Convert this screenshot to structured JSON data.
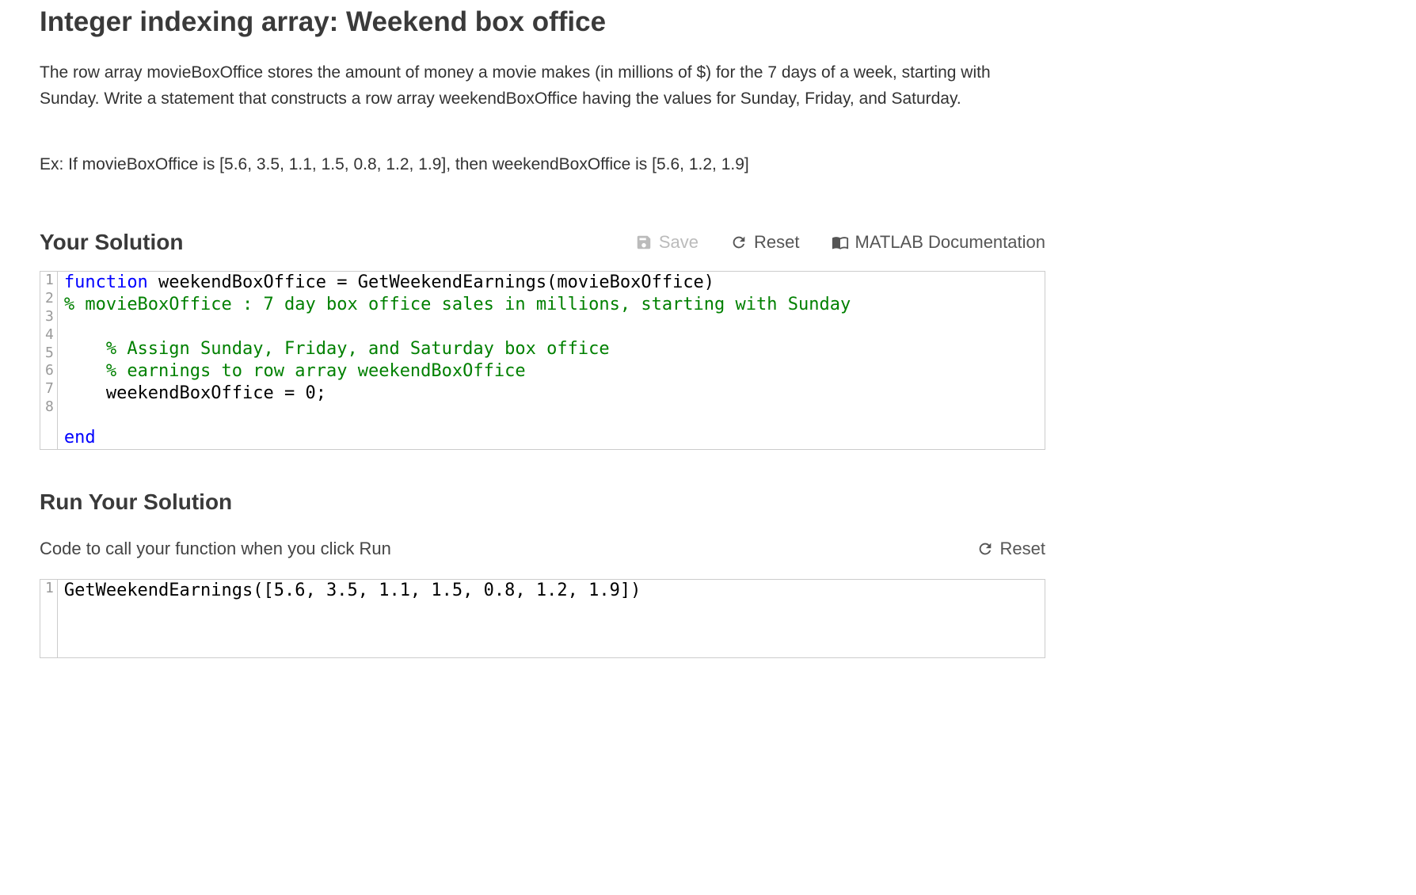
{
  "page_title": "Integer indexing array: Weekend box office",
  "description": "The row array movieBoxOffice stores the amount of money a movie makes (in millions of $) for the 7 days of a week, starting with Sunday. Write a statement that constructs a row array weekendBoxOffice having the values for Sunday, Friday, and Saturday.",
  "example": "Ex: If movieBoxOffice is [5.6, 3.5, 1.1, 1.5, 0.8, 1.2, 1.9], then weekendBoxOffice is [5.6, 1.2, 1.9]",
  "solution": {
    "title": "Your Solution",
    "toolbar": {
      "save": "Save",
      "reset": "Reset",
      "docs": "MATLAB Documentation"
    },
    "lines": [
      {
        "n": "1",
        "tokens": [
          {
            "t": "function",
            "c": "keyword"
          },
          {
            "t": " weekendBoxOffice = GetWeekendEarnings(movieBoxOffice)",
            "c": "plain"
          }
        ]
      },
      {
        "n": "2",
        "tokens": [
          {
            "t": "% movieBoxOffice : 7 day box office sales in millions, starting with Sunday",
            "c": "comment"
          }
        ]
      },
      {
        "n": "3",
        "tokens": [
          {
            "t": "",
            "c": "plain"
          }
        ]
      },
      {
        "n": "4",
        "tokens": [
          {
            "t": "    ",
            "c": "plain"
          },
          {
            "t": "% Assign Sunday, Friday, and Saturday box office",
            "c": "comment"
          }
        ]
      },
      {
        "n": "5",
        "tokens": [
          {
            "t": "    ",
            "c": "plain"
          },
          {
            "t": "% earnings to row array weekendBoxOffice",
            "c": "comment"
          }
        ]
      },
      {
        "n": "6",
        "tokens": [
          {
            "t": "    weekendBoxOffice = 0;",
            "c": "plain"
          }
        ]
      },
      {
        "n": "7",
        "tokens": [
          {
            "t": "",
            "c": "plain"
          }
        ]
      },
      {
        "n": "8",
        "tokens": [
          {
            "t": "end",
            "c": "keyword"
          }
        ]
      }
    ]
  },
  "run": {
    "title": "Run Your Solution",
    "subtitle": "Code to call your function when you click Run",
    "reset": "Reset",
    "lines": [
      {
        "n": "1",
        "tokens": [
          {
            "t": "GetWeekendEarnings([5.6, 3.5, 1.1, 1.5, 0.8, 1.2, 1.9])",
            "c": "plain"
          }
        ]
      }
    ]
  }
}
